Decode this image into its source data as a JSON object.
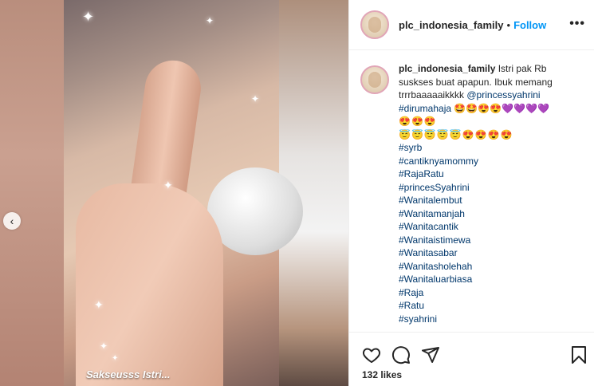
{
  "media": {
    "caption_overlay": "Sakseusss Istri...",
    "carousel_prev_glyph": "‹"
  },
  "header": {
    "username": "plc_indonesia_family",
    "separator": "•",
    "follow_label": "Follow",
    "more_glyph": "•••"
  },
  "post": {
    "username": "plc_indonesia_family",
    "text": " Istri pak Rb suskses buat apapun. Ibuk memang trrrbaaaaaikkkk ",
    "mention": "@princessyahrini",
    "hashtags_before_emoji": "#dirumahaja 🤩🤩😍😍💜💜💜💜",
    "emoji_line_1": "😍😍😍",
    "emoji_line_2": "😇😇😇😇😇😍😍😍😍",
    "hashtags": [
      "#syrb",
      "#cantiknyamommy",
      "#RajaRatu",
      "#princesSyahrini",
      "#Wanitalembut",
      "#Wanitamanjah",
      "#Wanitacantik",
      "#Wanitaistimewa",
      "#Wanitasabar",
      "#Wanitasholehah",
      "#Wanitaluarbiasa",
      "#Raja",
      "#Ratu",
      "#syahrini"
    ]
  },
  "actions": {
    "likes": "132 likes"
  },
  "icons": {
    "like": "heart-icon",
    "comment": "comment-icon",
    "share": "send-icon",
    "save": "bookmark-icon"
  },
  "colors": {
    "follow": "#0095f6",
    "link": "#00376b",
    "text": "#262626",
    "border": "#efefef"
  }
}
